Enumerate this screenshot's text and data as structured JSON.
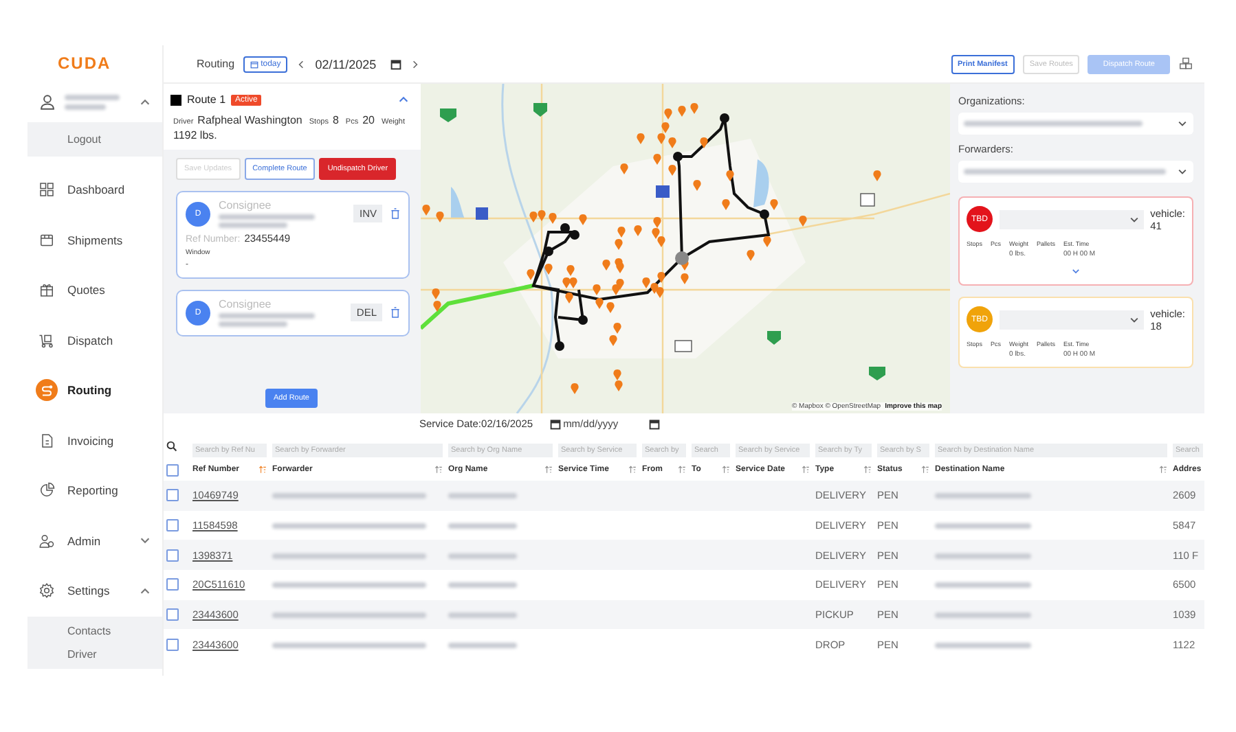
{
  "logo": "CUDA",
  "user": {
    "expanded": true,
    "menu": [
      {
        "label": "Logout"
      }
    ]
  },
  "nav": [
    {
      "label": "Dashboard",
      "selected": false
    },
    {
      "label": "Shipments",
      "selected": false
    },
    {
      "label": "Quotes",
      "selected": false
    },
    {
      "label": "Dispatch",
      "selected": false
    },
    {
      "label": "Routing",
      "selected": true
    },
    {
      "label": "Invoicing",
      "selected": false
    },
    {
      "label": "Reporting",
      "selected": false
    },
    {
      "label": "Admin",
      "selected": false,
      "expanded": false
    },
    {
      "label": "Settings",
      "selected": false,
      "expanded": true,
      "children": [
        {
          "label": "Contacts"
        },
        {
          "label": "Driver"
        }
      ]
    }
  ],
  "toolbar": {
    "title": "Routing",
    "today_button": "today",
    "date": "02/11/2025",
    "buttons": [
      {
        "label": "Print Manifest",
        "kind": "outline",
        "disabled": false
      },
      {
        "label": "Save Routes",
        "kind": "outline",
        "disabled": true
      },
      {
        "label": "Dispatch Route",
        "kind": "primary",
        "disabled": true
      }
    ]
  },
  "route": {
    "title": "Route 1",
    "status": "Active",
    "expanded": true,
    "driver_label": "Driver",
    "driver": "Rafpheal Washington",
    "stops_label": "Stops",
    "stops": "8",
    "pcs_label": "Pcs",
    "pcs": "20",
    "weight_label": "Weight",
    "weight": "1192 lbs.",
    "actions": [
      {
        "label": "Save Updates",
        "kind": "outline",
        "disabled": true
      },
      {
        "label": "Complete Route",
        "kind": "outline",
        "disabled": false
      },
      {
        "label": "Undispatch Driver",
        "kind": "danger",
        "disabled": false
      }
    ],
    "stop_cards": [
      {
        "avatar": "D",
        "role": "Consignee",
        "tag": "INV",
        "ref_label": "Ref Number:",
        "ref": "23455449",
        "window_label": "Window",
        "window": "-"
      },
      {
        "avatar": "D",
        "role": "Consignee",
        "tag": "DEL"
      }
    ],
    "add_button": "Add Route"
  },
  "map": {
    "attribution": "© Mapbox © OpenStreetMap",
    "improve_link": "Improve this map"
  },
  "filters": {
    "organizations_label": "Organizations:",
    "forwarders_label": "Forwarders:"
  },
  "vehicles": [
    {
      "badge": "TBD",
      "color": "#e3131b",
      "vehicle_label": "vehicle:",
      "vehicle": "41",
      "expanded": false,
      "stats": [
        {
          "label": "Stops"
        },
        {
          "label": "Pcs"
        },
        {
          "label": "Weight",
          "value": "0 lbs."
        },
        {
          "label": "Pallets"
        },
        {
          "label": "Est. Time",
          "value": "00 H 00 M"
        }
      ]
    },
    {
      "badge": "TBD",
      "color": "#f0a30a",
      "vehicle_label": "vehicle:",
      "vehicle": "18",
      "stats": [
        {
          "label": "Stops"
        },
        {
          "label": "Pcs"
        },
        {
          "label": "Weight",
          "value": "0 lbs."
        },
        {
          "label": "Pallets"
        },
        {
          "label": "Est. Time",
          "value": "00 H 00 M"
        }
      ]
    }
  ],
  "service_date": {
    "label": "Service Date:",
    "value": "02/16/2025",
    "end_placeholder": "mm/dd/yyyy"
  },
  "table": {
    "select_all_checked": false,
    "search_placeholders": [
      "Search by Ref Nu",
      "Search by Forwarder",
      "Search by Org Name",
      "Search by Service",
      "Search by",
      "Search",
      "Search by Service",
      "Search by Ty",
      "Search by S",
      "Search by Destination Name",
      "Search"
    ],
    "columns": [
      {
        "label": "Ref Number",
        "sorted": true
      },
      {
        "label": "Forwarder",
        "sorted": false
      },
      {
        "label": "Org Name",
        "sorted": false
      },
      {
        "label": "Service Time",
        "sorted": false
      },
      {
        "label": "From",
        "sorted": false
      },
      {
        "label": "To",
        "sorted": false
      },
      {
        "label": "Service Date",
        "sorted": false
      },
      {
        "label": "Type",
        "sorted": false
      },
      {
        "label": "Status",
        "sorted": false
      },
      {
        "label": "Destination Name",
        "sorted": false
      },
      {
        "label": "Addres"
      }
    ],
    "rows": [
      {
        "selected": false,
        "ref": "10469749",
        "type": "DELIVERY",
        "status": "PEN",
        "address": "2609"
      },
      {
        "selected": false,
        "ref": "11584598",
        "type": "DELIVERY",
        "status": "PEN",
        "address": "5847"
      },
      {
        "selected": false,
        "ref": "1398371",
        "type": "DELIVERY",
        "status": "PEN",
        "address": "110 F"
      },
      {
        "selected": false,
        "ref": "20C511610",
        "type": "DELIVERY",
        "status": "PEN",
        "address": "6500"
      },
      {
        "selected": false,
        "ref": "23443600",
        "type": "PICKUP",
        "status": "PEN",
        "address": "1039"
      },
      {
        "selected": false,
        "ref": "23443600",
        "type": "DROP",
        "status": "PEN",
        "address": "1122"
      }
    ]
  }
}
